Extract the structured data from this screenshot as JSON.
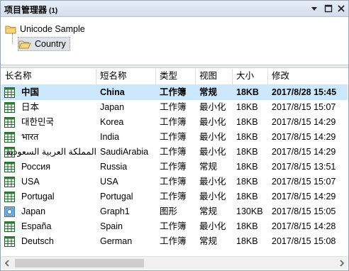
{
  "window": {
    "title": "项目管理器",
    "count": "(1)"
  },
  "tree": {
    "root_label": "Unicode Sample",
    "child_label": "Country"
  },
  "columns": [
    "长名称",
    "短名称",
    "类型",
    "视图",
    "大小",
    "修改"
  ],
  "rows": [
    {
      "long": "中国",
      "short": "China",
      "type": "工作簿",
      "view": "常规",
      "size": "18KB",
      "modified": "2017/8/28 15:45",
      "icon": "workbook-icon",
      "selected": true
    },
    {
      "long": "日本",
      "short": "Japan",
      "type": "工作簿",
      "view": "最小化",
      "size": "18KB",
      "modified": "2017/8/15 15:07",
      "icon": "workbook-icon",
      "selected": false
    },
    {
      "long": "대한민국",
      "short": "Korea",
      "type": "工作簿",
      "view": "最小化",
      "size": "18KB",
      "modified": "2017/8/15 14:29",
      "icon": "workbook-icon",
      "selected": false
    },
    {
      "long": "भारत",
      "short": "India",
      "type": "工作簿",
      "view": "最小化",
      "size": "18KB",
      "modified": "2017/8/15 14:29",
      "icon": "workbook-icon",
      "selected": false
    },
    {
      "long": "المملكة العربية السعودية",
      "short": "SaudiArabia",
      "type": "工作簿",
      "view": "最小化",
      "size": "18KB",
      "modified": "2017/8/15 14:29",
      "icon": "workbook-icon",
      "selected": false
    },
    {
      "long": "Россия",
      "short": "Russia",
      "type": "工作簿",
      "view": "常规",
      "size": "18KB",
      "modified": "2017/8/15 13:51",
      "icon": "workbook-icon",
      "selected": false
    },
    {
      "long": "USA",
      "short": "USA",
      "type": "工作簿",
      "view": "最小化",
      "size": "18KB",
      "modified": "2017/8/15 15:07",
      "icon": "workbook-icon",
      "selected": false
    },
    {
      "long": "Portugal",
      "short": "Portugal",
      "type": "工作簿",
      "view": "最小化",
      "size": "18KB",
      "modified": "2017/8/15 14:29",
      "icon": "workbook-icon",
      "selected": false
    },
    {
      "long": "Japan",
      "short": "Graph1",
      "type": "图形",
      "view": "常规",
      "size": "130KB",
      "modified": "2017/8/15 15:05",
      "icon": "graph-icon",
      "selected": false
    },
    {
      "long": "España",
      "short": "Spain",
      "type": "工作簿",
      "view": "最小化",
      "size": "18KB",
      "modified": "2017/8/15 14:28",
      "icon": "workbook-icon",
      "selected": false
    },
    {
      "long": "Deutsch",
      "short": "German",
      "type": "工作簿",
      "view": "常规",
      "size": "18KB",
      "modified": "2017/8/15 15:08",
      "icon": "workbook-icon",
      "selected": false
    }
  ],
  "colors": {
    "selection": "#cce8ff",
    "titlebar": "#d3ddec",
    "folder": "#f2cd6b",
    "workbook_green": "#2e7d32"
  }
}
